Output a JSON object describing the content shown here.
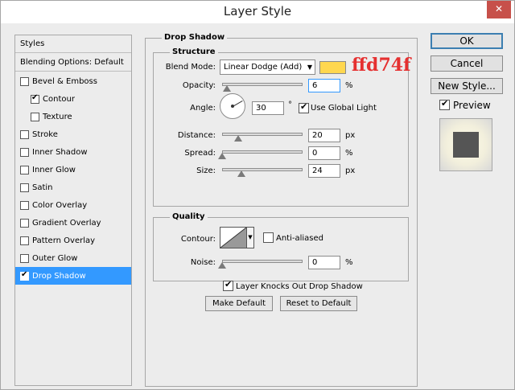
{
  "window": {
    "title": "Layer Style"
  },
  "style_list": {
    "header_styles": "Styles",
    "header_blending": "Blending Options: Default",
    "items": [
      {
        "label": "Bevel & Emboss",
        "checked": false
      },
      {
        "label": "Contour",
        "checked": true
      },
      {
        "label": "Texture",
        "checked": false
      },
      {
        "label": "Stroke",
        "checked": false
      },
      {
        "label": "Inner Shadow",
        "checked": false
      },
      {
        "label": "Inner Glow",
        "checked": false
      },
      {
        "label": "Satin",
        "checked": false
      },
      {
        "label": "Color Overlay",
        "checked": false
      },
      {
        "label": "Gradient Overlay",
        "checked": false
      },
      {
        "label": "Pattern Overlay",
        "checked": false
      },
      {
        "label": "Outer Glow",
        "checked": false
      },
      {
        "label": "Drop Shadow",
        "checked": true
      }
    ]
  },
  "panel": {
    "title": "Drop Shadow",
    "structure": {
      "title": "Structure",
      "blend_mode_label": "Blend Mode:",
      "blend_mode_value": "Linear Dodge (Add)",
      "color": "#ffd74f",
      "color_annotation": "ffd74f",
      "opacity_label": "Opacity:",
      "opacity_value": "6",
      "opacity_unit": "%",
      "opacity_level": 6,
      "angle_label": "Angle:",
      "angle_value": "30",
      "angle_unit": "°",
      "use_global_light_label": "Use Global Light",
      "use_global_light": true,
      "distance_label": "Distance:",
      "distance_value": "20",
      "distance_unit": "px",
      "distance_level": 20,
      "spread_label": "Spread:",
      "spread_value": "0",
      "spread_unit": "%",
      "spread_level": 0,
      "size_label": "Size:",
      "size_value": "24",
      "size_unit": "px",
      "size_level": 24
    },
    "quality": {
      "title": "Quality",
      "contour_label": "Contour:",
      "anti_aliased_label": "Anti-aliased",
      "anti_aliased": false,
      "noise_label": "Noise:",
      "noise_value": "0",
      "noise_unit": "%",
      "noise_level": 0
    },
    "layer_knocks_out_label": "Layer Knocks Out Drop Shadow",
    "layer_knocks_out": true,
    "make_default_label": "Make Default",
    "reset_default_label": "Reset to Default"
  },
  "buttons": {
    "ok": "OK",
    "cancel": "Cancel",
    "new_style": "New Style...",
    "preview_label": "Preview",
    "preview_checked": true
  },
  "icons": {
    "close": "close-icon",
    "dropdown": "chevron-down-icon",
    "check": "checkmark-icon"
  }
}
